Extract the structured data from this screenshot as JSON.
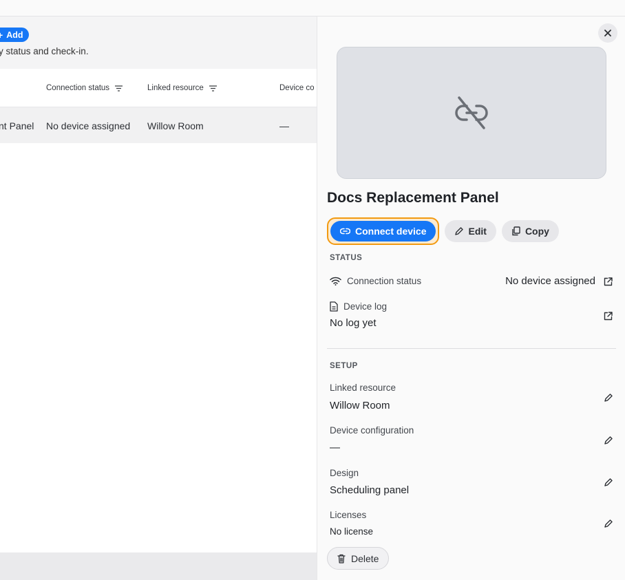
{
  "background": {
    "add_button": "Add",
    "subtitle": "y status and check-in.",
    "table": {
      "columns": [
        "Connection status",
        "Linked resource",
        "Device co"
      ],
      "row": {
        "name": "nt Panel",
        "connection_status": "No device assigned",
        "linked_resource": "Willow Room",
        "device_config": "—"
      }
    }
  },
  "panel": {
    "title": "Docs Replacement Panel",
    "actions": {
      "connect": "Connect device",
      "edit": "Edit",
      "copy": "Copy"
    },
    "status_section": {
      "label": "STATUS",
      "connection_status_label": "Connection status",
      "connection_status_value": "No device assigned",
      "device_log_label": "Device log",
      "device_log_value": "No log yet"
    },
    "setup_section": {
      "label": "SETUP",
      "linked_resource_label": "Linked resource",
      "linked_resource_value": "Willow Room",
      "device_configuration_label": "Device configuration",
      "device_configuration_value": "—",
      "design_label": "Design",
      "design_value": "Scheduling panel",
      "licenses_label": "Licenses",
      "licenses_value": "No license"
    },
    "delete_button": "Delete"
  },
  "colors": {
    "primary": "#1677f6",
    "focus_ring": "#f29a11"
  }
}
